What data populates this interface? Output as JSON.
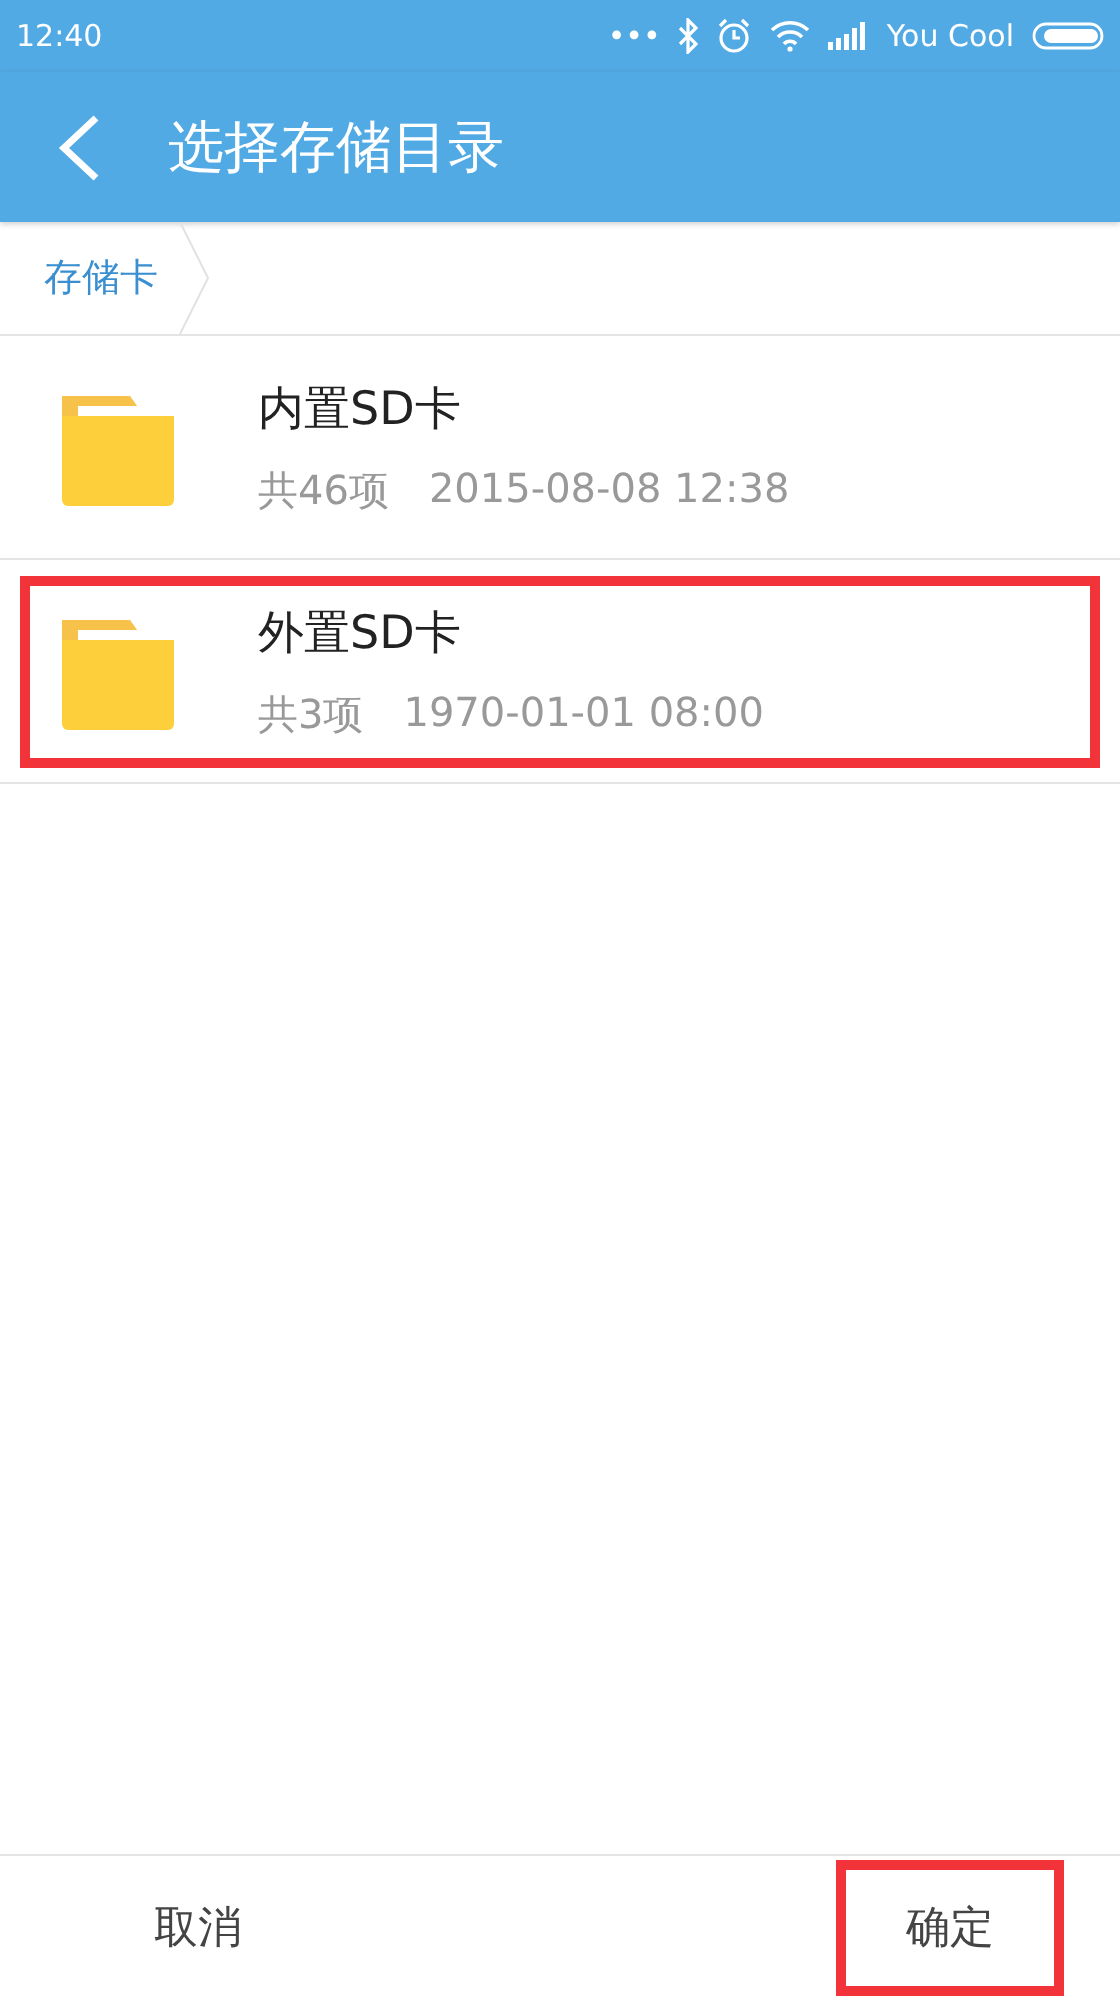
{
  "status_bar": {
    "time": "12:40",
    "dots": "•••",
    "carrier": "You Cool"
  },
  "app_bar": {
    "title": "选择存储目录"
  },
  "breadcrumb": [
    {
      "label": "存储卡"
    }
  ],
  "items": [
    {
      "name": "内置SD卡",
      "count": "共46项",
      "date": "2015-08-08 12:38",
      "highlighted": false
    },
    {
      "name": "外置SD卡",
      "count": "共3项",
      "date": "1970-01-01 08:00",
      "highlighted": true
    }
  ],
  "buttons": [
    {
      "label": "取消",
      "highlighted": false
    },
    {
      "label": "确定",
      "highlighted": true
    }
  ]
}
